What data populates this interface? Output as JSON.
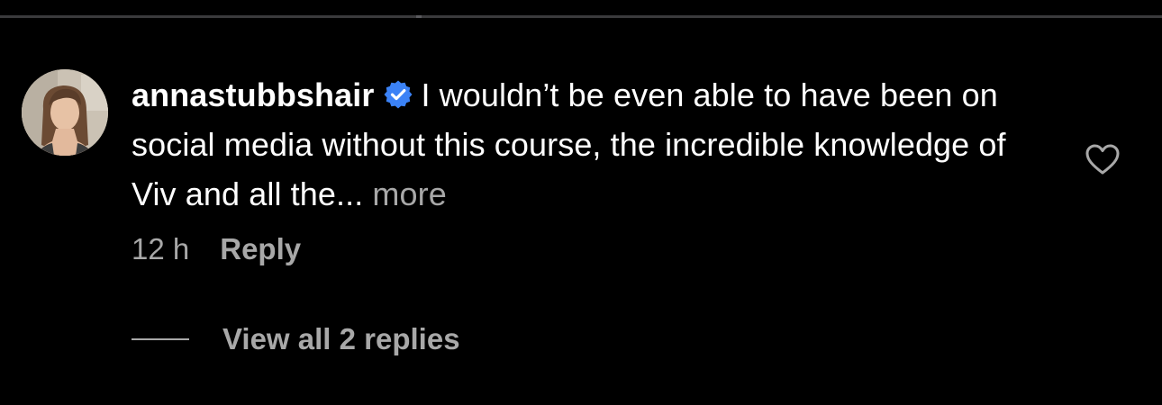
{
  "comment": {
    "username": "annastubbshair",
    "verified_icon": "verified-badge-icon",
    "text": "I wouldn’t be even able to have been on social media without this course, the incredible knowledge of Viv and all the...",
    "more_label": "more",
    "timestamp": "12 h",
    "reply_label": "Reply",
    "like_icon": "heart-outline-icon",
    "view_replies_label": "View all 2 replies"
  },
  "colors": {
    "background": "#000000",
    "primary_text": "#ffffff",
    "secondary_text": "#a8a8a8",
    "verified_blue": "#3b82f6",
    "divider": "#3a3a3c"
  }
}
